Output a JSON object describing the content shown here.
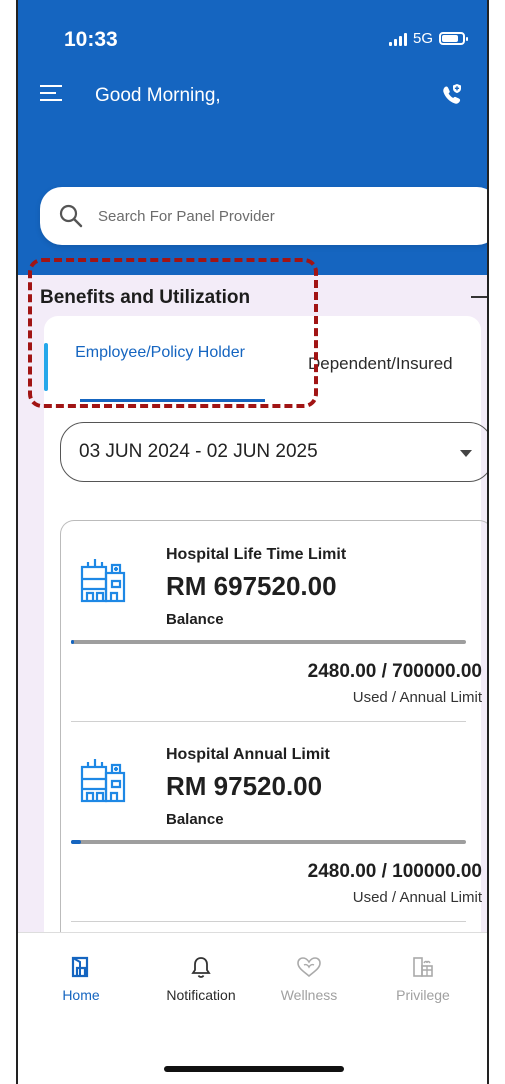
{
  "status_bar": {
    "time": "10:33",
    "network": "5G"
  },
  "header": {
    "greeting": "Good Morning,"
  },
  "search": {
    "placeholder": "Search For Panel Provider"
  },
  "section": {
    "title": "Benefits and Utilization"
  },
  "tabs": [
    {
      "label": "Employee/Policy Holder",
      "active": true
    },
    {
      "label": "Dependent/Insured",
      "active": false
    }
  ],
  "period": {
    "selected": "03 JUN 2024 - 02 JUN 2025"
  },
  "benefits": [
    {
      "name": "Hospital Life Time Limit",
      "balance": "RM 697520.00",
      "balance_label": "Balance",
      "usage": "2480.00 / 700000.00",
      "usage_label": "Used / Annual Limit",
      "used_fraction": 0.0035
    },
    {
      "name": "Hospital Annual Limit",
      "balance": "RM 97520.00",
      "balance_label": "Balance",
      "usage": "2480.00 / 100000.00",
      "usage_label": "Used / Annual Limit",
      "used_fraction": 0.0248
    }
  ],
  "nav": [
    {
      "label": "Home",
      "icon": "home-icon",
      "active": true
    },
    {
      "label": "Notification",
      "icon": "bell-icon",
      "active": false
    },
    {
      "label": "Wellness",
      "icon": "wellness-icon",
      "active": false
    },
    {
      "label": "Privilege",
      "icon": "gift-icon",
      "active": false
    }
  ],
  "colors": {
    "primary": "#1565c0",
    "accent": "#26a7ea",
    "annotation": "#a11414",
    "background": "#f3ecf8"
  }
}
